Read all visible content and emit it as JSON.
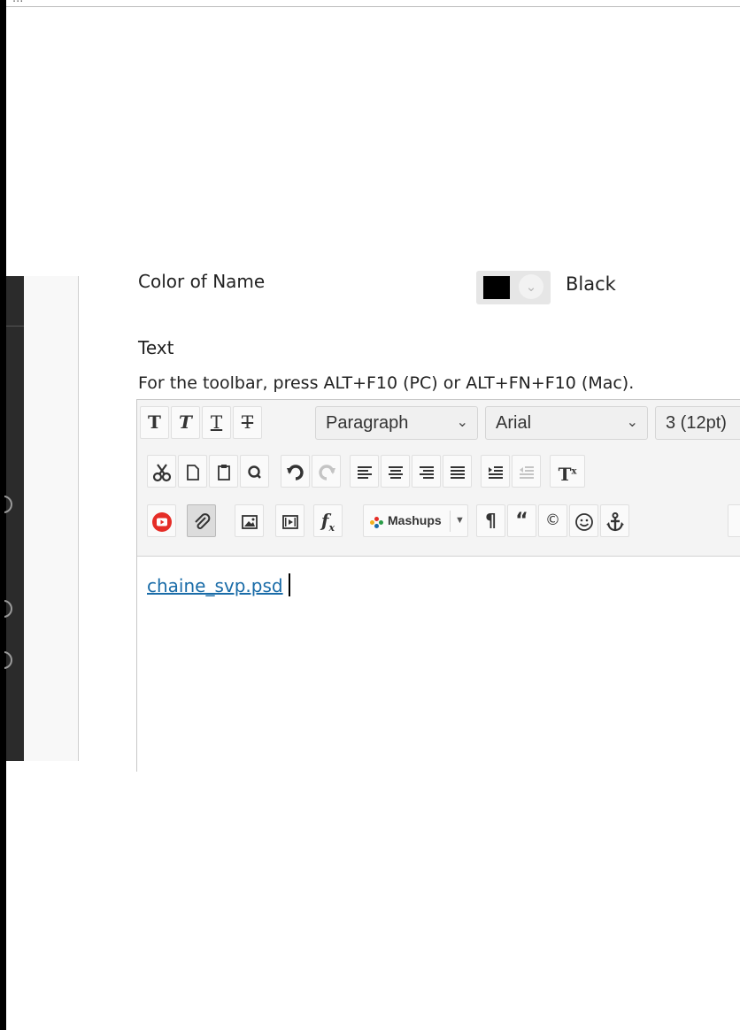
{
  "window": {
    "top_clip_text": "..."
  },
  "form": {
    "color_label": "Color of Name",
    "color_value": "Black",
    "swatch_color": "#000000",
    "text_label": "Text",
    "toolbar_hint": "For the toolbar, press ALT+F10 (PC) or ALT+FN+F10 (Mac)."
  },
  "toolbar": {
    "row1": {
      "bold": "T",
      "italic": "T",
      "underline": "T",
      "strikethrough": "T",
      "block_format": "Paragraph",
      "font_family": "Arial",
      "font_size": "3 (12pt)"
    },
    "row2": {
      "icons": [
        "cut-icon",
        "copy-icon",
        "paste-icon",
        "find-icon",
        "undo-icon",
        "redo-icon",
        "align-left-icon",
        "align-center-icon",
        "align-right-icon",
        "align-justify-icon",
        "indent-icon",
        "outdent-icon",
        "superscript-icon"
      ]
    },
    "row3": {
      "mashups_label": "Mashups",
      "icons": [
        "youtube-icon",
        "attach-icon",
        "image-icon",
        "media-icon",
        "math-formula-icon",
        "paragraph-mark-icon",
        "quote-icon",
        "copyright-icon",
        "emoticon-icon",
        "anchor-icon"
      ]
    }
  },
  "editor": {
    "link_text": "chaine_svp.psd"
  },
  "colors": {
    "link": "#1a6ca8",
    "youtube": "#e52d27",
    "rail": "#2b2b2b"
  }
}
